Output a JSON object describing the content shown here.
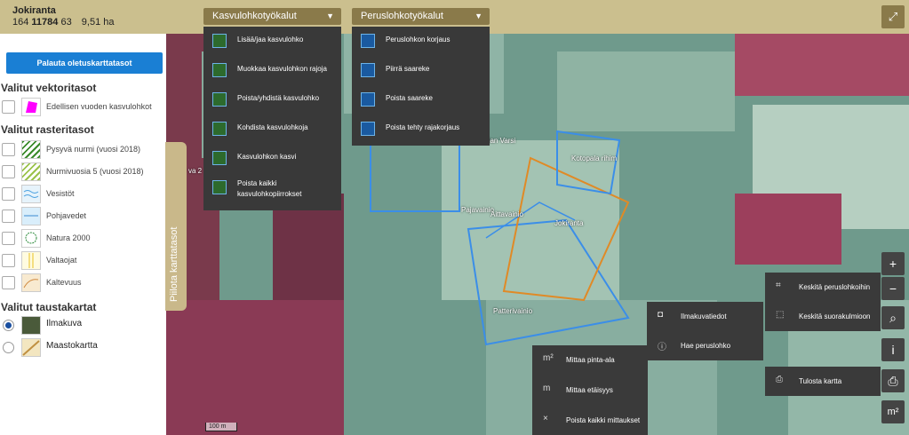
{
  "parcel": {
    "name": "Jokiranta",
    "code_pre": "164",
    "code_bold": "11784",
    "code_post": "63",
    "area": "9,51 ha"
  },
  "toolbars": {
    "kasvulohko": {
      "title": "Kasvulohkotyökalut",
      "items": [
        {
          "label": "Lisää/jaa kasvulohko",
          "icon": "add-split-icon"
        },
        {
          "label": "Muokkaa kasvulohkon rajoja",
          "icon": "edit-boundary-icon"
        },
        {
          "label": "Poista/yhdistä kasvulohko",
          "icon": "delete-merge-icon"
        },
        {
          "label": "Kohdista kasvulohkoja",
          "icon": "align-icon"
        },
        {
          "label": "Kasvulohkon kasvi",
          "icon": "crop-icon"
        },
        {
          "label": "Poista kaikki kasvulohkopiirrokset",
          "icon": "delete-all-icon"
        }
      ]
    },
    "peruslohko": {
      "title": "Peruslohkotyökalut",
      "items": [
        {
          "label": "Peruslohkon korjaus",
          "icon": "correct-icon"
        },
        {
          "label": "Piirrä saareke",
          "icon": "draw-island-icon"
        },
        {
          "label": "Poista saareke",
          "icon": "remove-island-icon"
        },
        {
          "label": "Poista tehty rajakorjaus",
          "icon": "undo-correction-icon"
        }
      ]
    }
  },
  "sidebar": {
    "reset_button": "Palauta oletuskarttatasot",
    "vector_title": "Valitut vektoritasot",
    "vector_layers": [
      {
        "label": "Edellisen vuoden kasvulohkot",
        "color": "#ff00ff"
      }
    ],
    "raster_title": "Valitut rasteritasot",
    "raster_layers": [
      {
        "label": "Pysyvä nurmi (vuosi 2018)"
      },
      {
        "label": "Nurmivuosia 5 (vuosi 2018)"
      },
      {
        "label": "Vesistöt"
      },
      {
        "label": "Pohjavedet"
      },
      {
        "label": "Natura 2000"
      },
      {
        "label": "Valtaojat"
      },
      {
        "label": "Kaltevuus"
      }
    ],
    "base_title": "Valitut taustakartat",
    "base_layers": [
      {
        "label": "Ilmakuva",
        "selected": true
      },
      {
        "label": "Maastokartta",
        "selected": false
      }
    ],
    "hide_tab": "Piilota karttatasot"
  },
  "map": {
    "labels": [
      "Kotopala rihim",
      "Jokiranta",
      "Pajavainio",
      "Aittavainio",
      "Patterivainio",
      "dan Varsi",
      "va 2"
    ],
    "scale": "100 m"
  },
  "popups": {
    "measure": [
      "Mittaa pinta-ala",
      "Mittaa etäisyys",
      "Poista kaikki mittaukset"
    ],
    "measure_icons": [
      "m²",
      "m",
      "×"
    ],
    "search": [
      "Ilmakuvatiedot",
      "Hae peruslohko"
    ],
    "center": [
      "Keskitä peruslohkoihin",
      "Keskitä suorakulmioon"
    ],
    "print": "Tulosta kartta"
  },
  "tools": {
    "zoom_in": "+",
    "zoom_out": "−",
    "search": "⌕",
    "info": "i",
    "print": "⎙",
    "measure": "m²",
    "expand": "⤢"
  }
}
